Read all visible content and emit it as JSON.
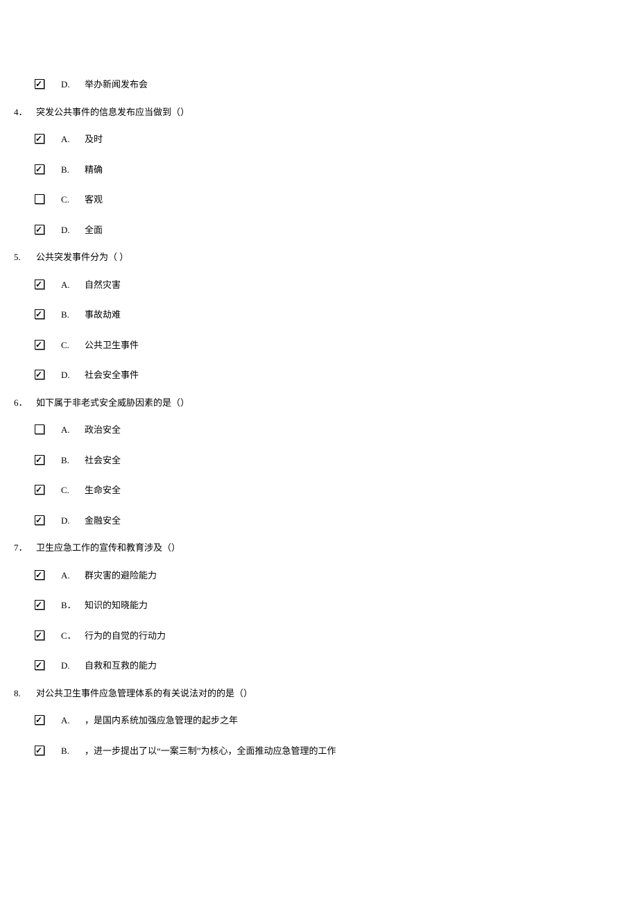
{
  "orphan": {
    "option": {
      "letter": "D.",
      "text": "举办新闻发布会",
      "checked": true
    }
  },
  "questions": [
    {
      "num": "4．",
      "text": "突发公共事件的信息发布应当做到（）",
      "options": [
        {
          "letter": "A.",
          "text": "及时",
          "checked": true
        },
        {
          "letter": "B.",
          "text": "精确",
          "checked": true
        },
        {
          "letter": "C.",
          "text": "客观",
          "checked": false
        },
        {
          "letter": "D.",
          "text": "全面",
          "checked": true
        }
      ]
    },
    {
      "num": "5.",
      "text": "公共突发事件分为（ ）",
      "options": [
        {
          "letter": "A.",
          "text": "自然灾害",
          "checked": true
        },
        {
          "letter": "B.",
          "text": "事故劫难",
          "checked": true
        },
        {
          "letter": "C.",
          "text": "公共卫生事件",
          "checked": true
        },
        {
          "letter": "D.",
          "text": "社会安全事件",
          "checked": true
        }
      ]
    },
    {
      "num": "6．",
      "text": "如下属于非老式安全威胁因素的是（）",
      "options": [
        {
          "letter": "A.",
          "text": "政治安全",
          "checked": false
        },
        {
          "letter": "B.",
          "text": "社会安全",
          "checked": true
        },
        {
          "letter": "C.",
          "text": "生命安全",
          "checked": true
        },
        {
          "letter": "D.",
          "text": "金融安全",
          "checked": true
        }
      ]
    },
    {
      "num": "7．",
      "text": " 卫生应急工作的宣传和教育涉及（）",
      "options": [
        {
          "letter": "A.",
          "text": "群灾害的避险能力",
          "checked": true
        },
        {
          "letter": "B．",
          "text": "知识的知晓能力",
          "checked": true
        },
        {
          "letter": "C．",
          "text": " 行为的自觉的行动力",
          "checked": true
        },
        {
          "letter": "D.",
          "text": "自救和互救的能力",
          "checked": true
        }
      ]
    },
    {
      "num": "8.",
      "text": " 对公共卫生事件应急管理体系的有关说法对的的是（）",
      "options": [
        {
          "letter": "A.",
          "text": "，是国内系统加强应急管理的起步之年",
          "checked": true
        },
        {
          "letter": "B.",
          "text": "，进一步提出了以“一案三制”为核心，全面推动应急管理的工作",
          "checked": true
        }
      ]
    }
  ]
}
